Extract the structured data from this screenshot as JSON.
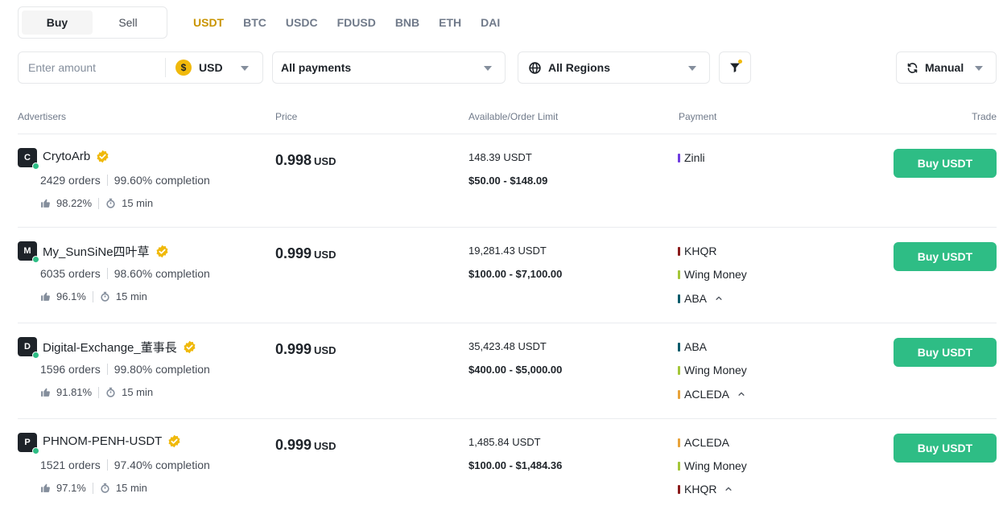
{
  "trade_toggle": {
    "buy": "Buy",
    "sell": "Sell",
    "active": "buy"
  },
  "coins": [
    "USDT",
    "BTC",
    "USDC",
    "FDUSD",
    "BNB",
    "ETH",
    "DAI"
  ],
  "active_coin": "USDT",
  "filters": {
    "amount_placeholder": "Enter amount",
    "currency_symbol": "$",
    "currency": "USD",
    "payments": "All payments",
    "regions": "All Regions",
    "sort": "Manual"
  },
  "colors": {
    "accent": "#c99400",
    "buy_green": "#2ebd85",
    "online": "#2ebd85",
    "verified": "#f0b90b"
  },
  "table": {
    "headers": {
      "advertisers": "Advertisers",
      "price": "Price",
      "available": "Available/Order Limit",
      "payment": "Payment",
      "trade": "Trade"
    },
    "rows": [
      {
        "initial": "C",
        "name": "CrytoArb",
        "orders": "2429 orders",
        "completion": "99.60% completion",
        "rating": "98.22%",
        "time": "15 min",
        "price": "0.998",
        "price_unit": "USD",
        "available": "148.39 USDT",
        "limit": "$50.00 - $148.09",
        "payments": [
          {
            "name": "Zinli",
            "color": "#6f3ce0"
          }
        ],
        "button": "Buy USDT"
      },
      {
        "initial": "M",
        "name": "My_SunSiNe四叶草",
        "orders": "6035 orders",
        "completion": "98.60% completion",
        "rating": "96.1%",
        "time": "15 min",
        "price": "0.999",
        "price_unit": "USD",
        "available": "19,281.43 USDT",
        "limit": "$100.00 - $7,100.00",
        "payments": [
          {
            "name": "KHQR",
            "color": "#8b1c1c"
          },
          {
            "name": "Wing Money",
            "color": "#a4c639"
          },
          {
            "name": "ABA",
            "color": "#0b5b6b"
          }
        ],
        "button": "Buy USDT"
      },
      {
        "initial": "D",
        "name": "Digital-Exchange_董事長",
        "orders": "1596 orders",
        "completion": "99.80% completion",
        "rating": "91.81%",
        "time": "15 min",
        "price": "0.999",
        "price_unit": "USD",
        "available": "35,423.48 USDT",
        "limit": "$400.00 - $5,000.00",
        "payments": [
          {
            "name": "ABA",
            "color": "#0b5b6b"
          },
          {
            "name": "Wing Money",
            "color": "#a4c639"
          },
          {
            "name": "ACLEDA",
            "color": "#e8a33a"
          }
        ],
        "button": "Buy USDT"
      },
      {
        "initial": "P",
        "name": "PHNOM-PENH-USDT",
        "orders": "1521 orders",
        "completion": "97.40% completion",
        "rating": "97.1%",
        "time": "15 min",
        "price": "0.999",
        "price_unit": "USD",
        "available": "1,485.84 USDT",
        "limit": "$100.00 - $1,484.36",
        "payments": [
          {
            "name": "ACLEDA",
            "color": "#e8a33a"
          },
          {
            "name": "Wing Money",
            "color": "#a4c639"
          },
          {
            "name": "KHQR",
            "color": "#8b1c1c"
          }
        ],
        "button": "Buy USDT"
      }
    ]
  }
}
